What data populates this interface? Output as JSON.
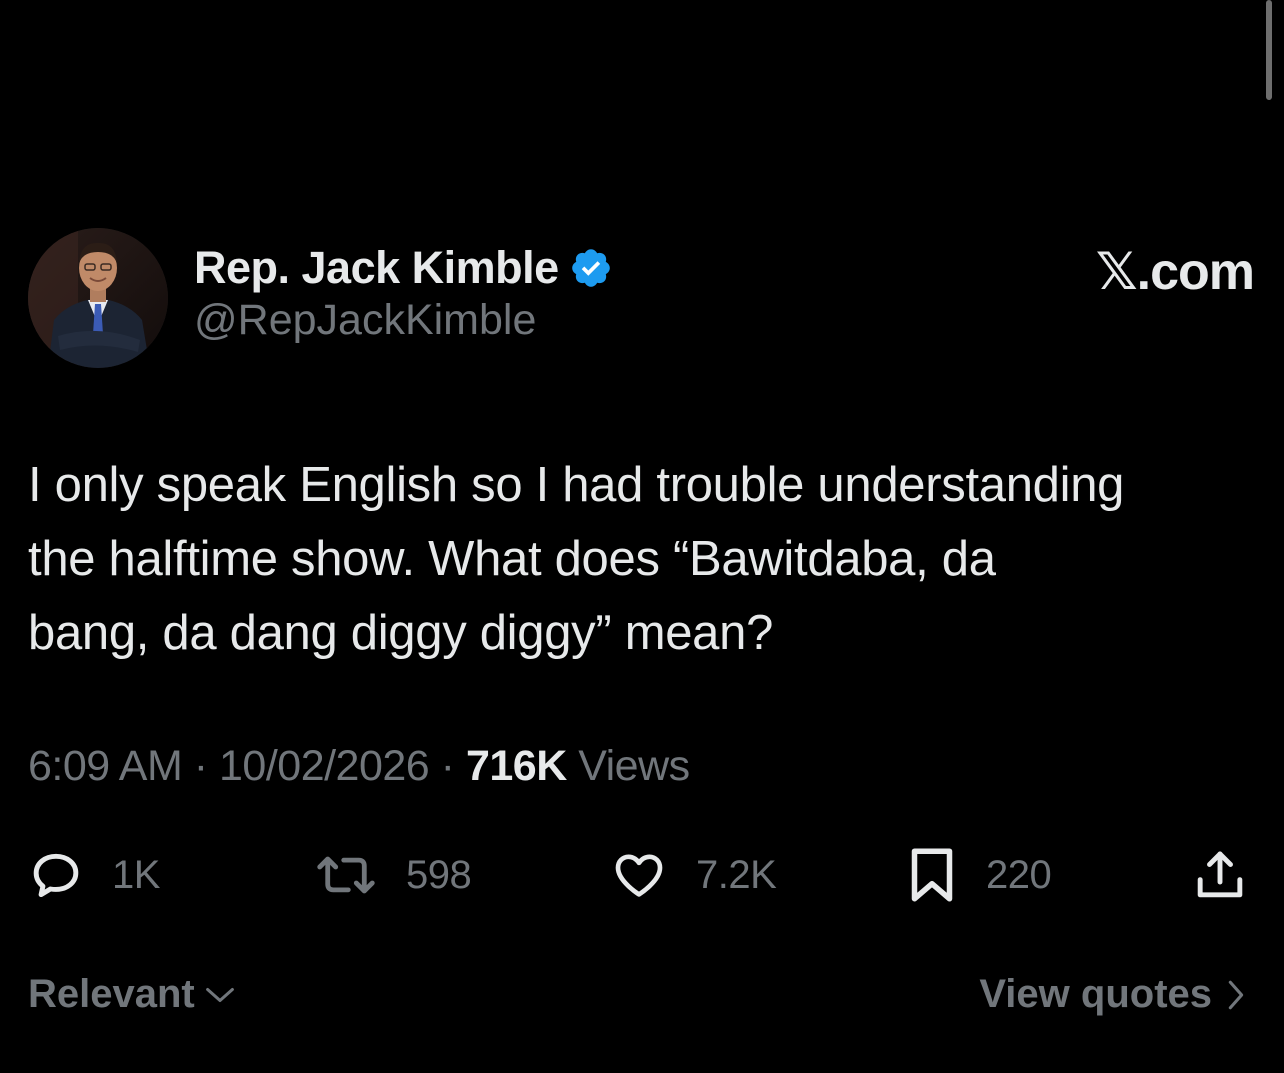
{
  "tweet": {
    "author": {
      "display_name": "Rep. Jack Kimble",
      "handle": "@RepJackKimble",
      "verified": true
    },
    "brand": "𝕏.com",
    "text_lines": [
      "I only speak English so I had trouble understanding",
      "the halftime show. What does “Bawitdaba, da",
      "bang, da dang diggy diggy” mean?"
    ],
    "meta": {
      "time": "6:09 AM",
      "separator": "·",
      "date": "10/02/2026",
      "views_count": "716K",
      "views_label": "Views"
    },
    "actions": {
      "replies": "1K",
      "reposts": "598",
      "likes": "7.2K",
      "bookmarks": "220"
    }
  },
  "footer": {
    "sort_label": "Relevant",
    "quotes_label": "View quotes"
  },
  "colors": {
    "background": "#000000",
    "primary_text": "#e7e9ea",
    "secondary_text": "#71767b",
    "verified_blue": "#1d9bf0"
  },
  "icons": {
    "verified": "verified-badge-icon",
    "reply": "reply-icon",
    "repost": "repost-icon",
    "like": "heart-icon",
    "bookmark": "bookmark-icon",
    "share": "share-icon",
    "chevron_down": "chevron-down-icon",
    "chevron_right": "chevron-right-icon"
  }
}
